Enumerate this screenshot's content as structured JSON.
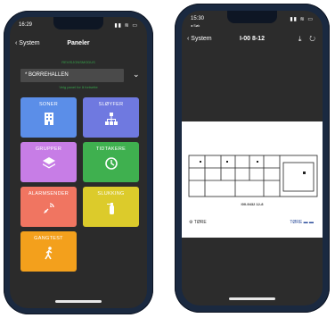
{
  "phone1": {
    "status": {
      "time": "16:29",
      "icons": "▮▮ ≋ ▭"
    },
    "nav": {
      "back_label": "System",
      "title": "Paneler"
    },
    "hint_top": "REVISJONSMODUS",
    "dropdown": {
      "value": "* BORREHALLEN"
    },
    "hint_bottom": "Velg panel for å fortsette",
    "tiles": [
      {
        "label": "SONER",
        "color": "#5b8ee8",
        "icon": "building-icon"
      },
      {
        "label": "SLØYFER",
        "color": "#6f79e0",
        "icon": "hierarchy-icon"
      },
      {
        "label": "GRUPPER",
        "color": "#c77de6",
        "icon": "layers-icon"
      },
      {
        "label": "TIDTAKERE",
        "color": "#3fb04f",
        "icon": "clock-icon"
      },
      {
        "label": "ALARMSENDER",
        "color": "#f07561",
        "icon": "satellite-icon"
      },
      {
        "label": "SLUKKING",
        "color": "#dccb2b",
        "icon": "extinguisher-icon"
      },
      {
        "label": "GANGTEST",
        "color": "#f3a01c",
        "icon": "walking-icon"
      }
    ]
  },
  "phone2": {
    "status": {
      "time": "15:30",
      "sub": "◂ Søk",
      "icons": "▮▮ ≋ ▭"
    },
    "nav": {
      "back_label": "System",
      "title": "I-00 8-12"
    },
    "drawing": {
      "caption": "I00-9432 12-8",
      "legend_left": "TØRE",
      "legend_right": "TØRE ▬ ▬"
    }
  }
}
